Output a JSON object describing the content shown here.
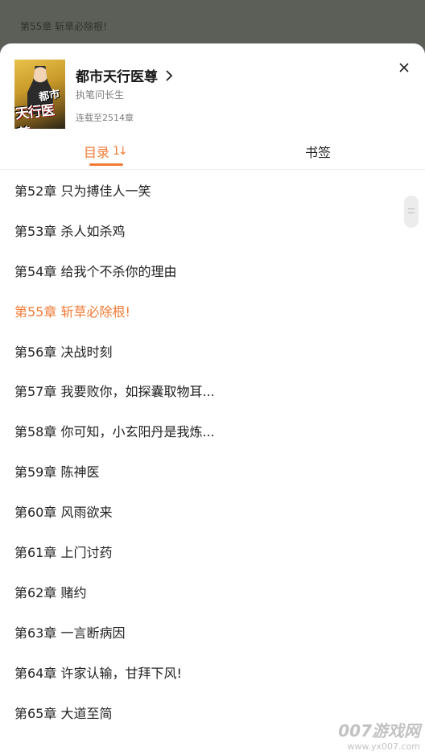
{
  "background": {
    "current_chapter": "第55章 斩草必除根!"
  },
  "book": {
    "title": "都市天行医尊",
    "author": "执笔问长生",
    "status": "连载至2514章",
    "cover_text_1": "都市",
    "cover_text_2": "天行医尊"
  },
  "tabs": {
    "toc_label": "目录",
    "sort_icon_text": "1↓",
    "bookmark_label": "书签"
  },
  "chapters": [
    {
      "label": "第52章 只为搏佳人一笑"
    },
    {
      "label": "第53章 杀人如杀鸡"
    },
    {
      "label": "第54章 给我个不杀你的理由"
    },
    {
      "label": "第55章 斩草必除根!",
      "current": true
    },
    {
      "label": "第56章 决战时刻"
    },
    {
      "label": "第57章 我要败你，如探囊取物耳..."
    },
    {
      "label": "第58章 你可知，小玄阳丹是我炼..."
    },
    {
      "label": "第59章 陈神医"
    },
    {
      "label": "第60章 风雨欲来"
    },
    {
      "label": "第61章 上门讨药"
    },
    {
      "label": "第62章 赌约"
    },
    {
      "label": "第63章 一言断病因"
    },
    {
      "label": "第64章 许家认输，甘拜下风!"
    },
    {
      "label": "第65章 大道至简"
    }
  ],
  "watermark": {
    "line1": "007游戏网",
    "line2": "www.yx007.com"
  },
  "colors": {
    "accent": "#f07a34",
    "overlay": "#5b5f58"
  }
}
